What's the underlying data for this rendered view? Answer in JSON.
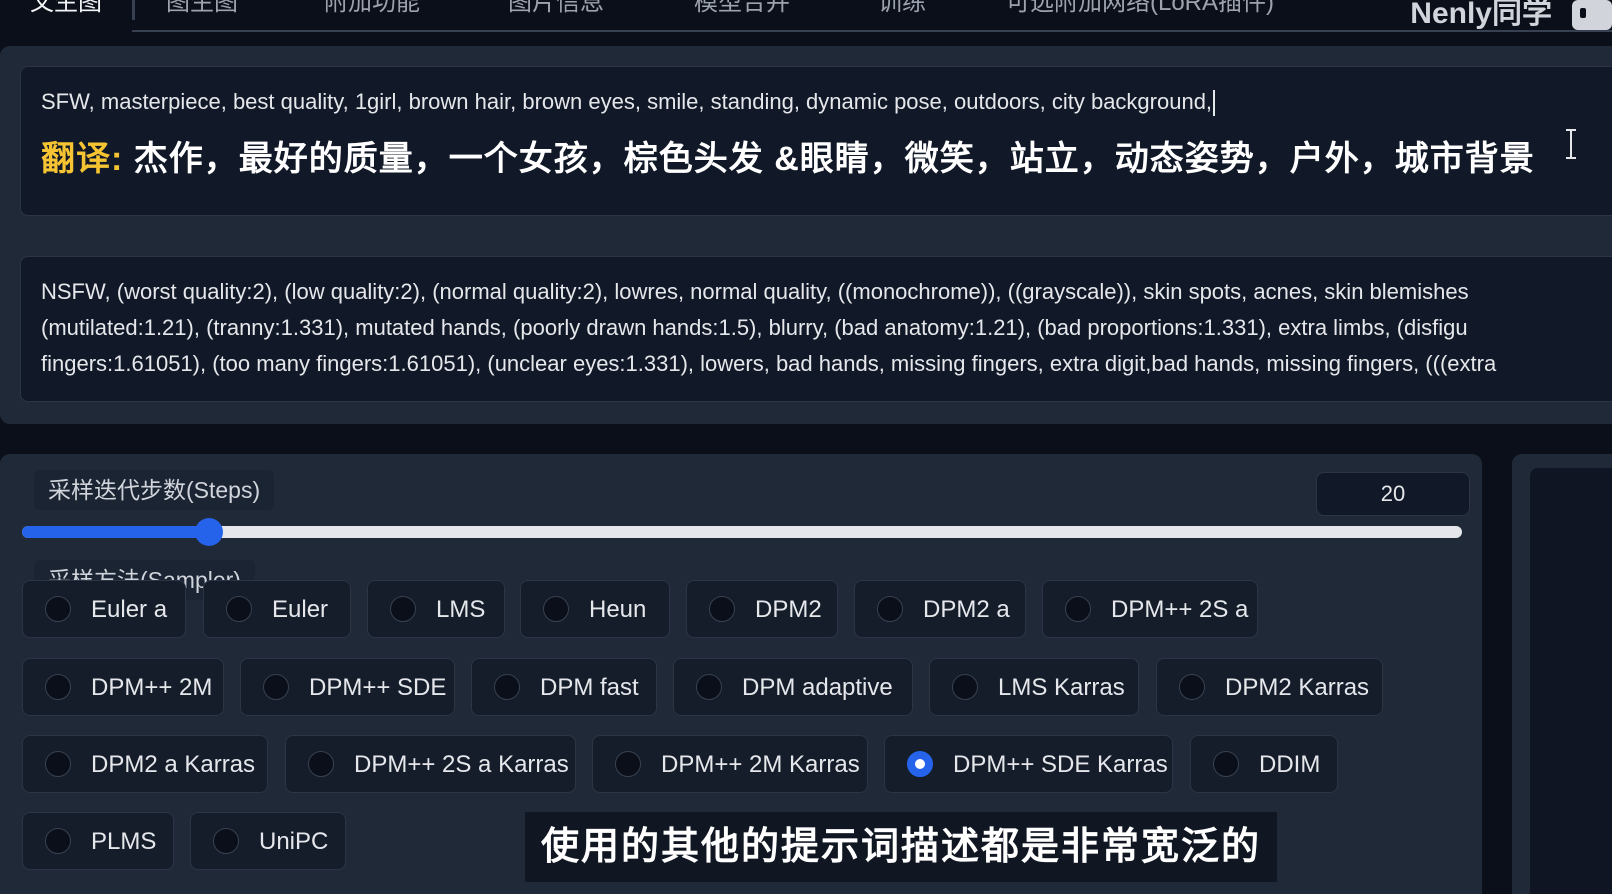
{
  "tabs": [
    {
      "label": "文生图",
      "active": true
    },
    {
      "label": "图生图"
    },
    {
      "label": "附加功能"
    },
    {
      "label": "图片信息"
    },
    {
      "label": "模型合并"
    },
    {
      "label": "训练"
    },
    {
      "label": "可选附加网络(LoRA插件)"
    }
  ],
  "watermark": "Nenly同学",
  "prompt": {
    "positive": "SFW, masterpiece, best quality, 1girl, brown hair, brown eyes, smile, standing, dynamic pose, outdoors, city background,",
    "translation_label": "翻译:",
    "translation_text": "杰作，最好的质量，一个女孩，棕色头发 &眼睛，微笑，站立，动态姿势，户外，城市背景",
    "negative_lines": [
      "NSFW, (worst quality:2), (low quality:2), (normal quality:2), lowres, normal quality, ((monochrome)), ((grayscale)), skin spots, acnes, skin blemishes",
      "(mutilated:1.21), (tranny:1.331), mutated hands, (poorly drawn hands:1.5), blurry, (bad anatomy:1.21), (bad proportions:1.331), extra limbs, (disfigu",
      "fingers:1.61051), (too many fingers:1.61051), (unclear eyes:1.331), lowers, bad hands, missing fingers, extra digit,bad hands, missing fingers, (((extra"
    ]
  },
  "steps": {
    "label": "采样迭代步数(Steps)",
    "value": "20",
    "min": 1,
    "max": 150
  },
  "sampler": {
    "label": "采样方法(Sampler)",
    "selected": "DPM++ SDE Karras",
    "options": [
      "Euler a",
      "Euler",
      "LMS",
      "Heun",
      "DPM2",
      "DPM2 a",
      "DPM++ 2S a",
      "DPM++ 2M",
      "DPM++ SDE",
      "DPM fast",
      "DPM adaptive",
      "LMS Karras",
      "DPM2 Karras",
      "DPM2 a Karras",
      "DPM++ 2S a Karras",
      "DPM++ 2M Karras",
      "DPM++ SDE Karras",
      "DDIM",
      "PLMS",
      "UniPC"
    ]
  },
  "subtitle": "使用的其他的提示词描述都是非常宽泛的",
  "colors": {
    "accent": "#2563eb",
    "translation_label": "#f6c432",
    "panel": "#1f2937",
    "background": "#0b0f19"
  }
}
